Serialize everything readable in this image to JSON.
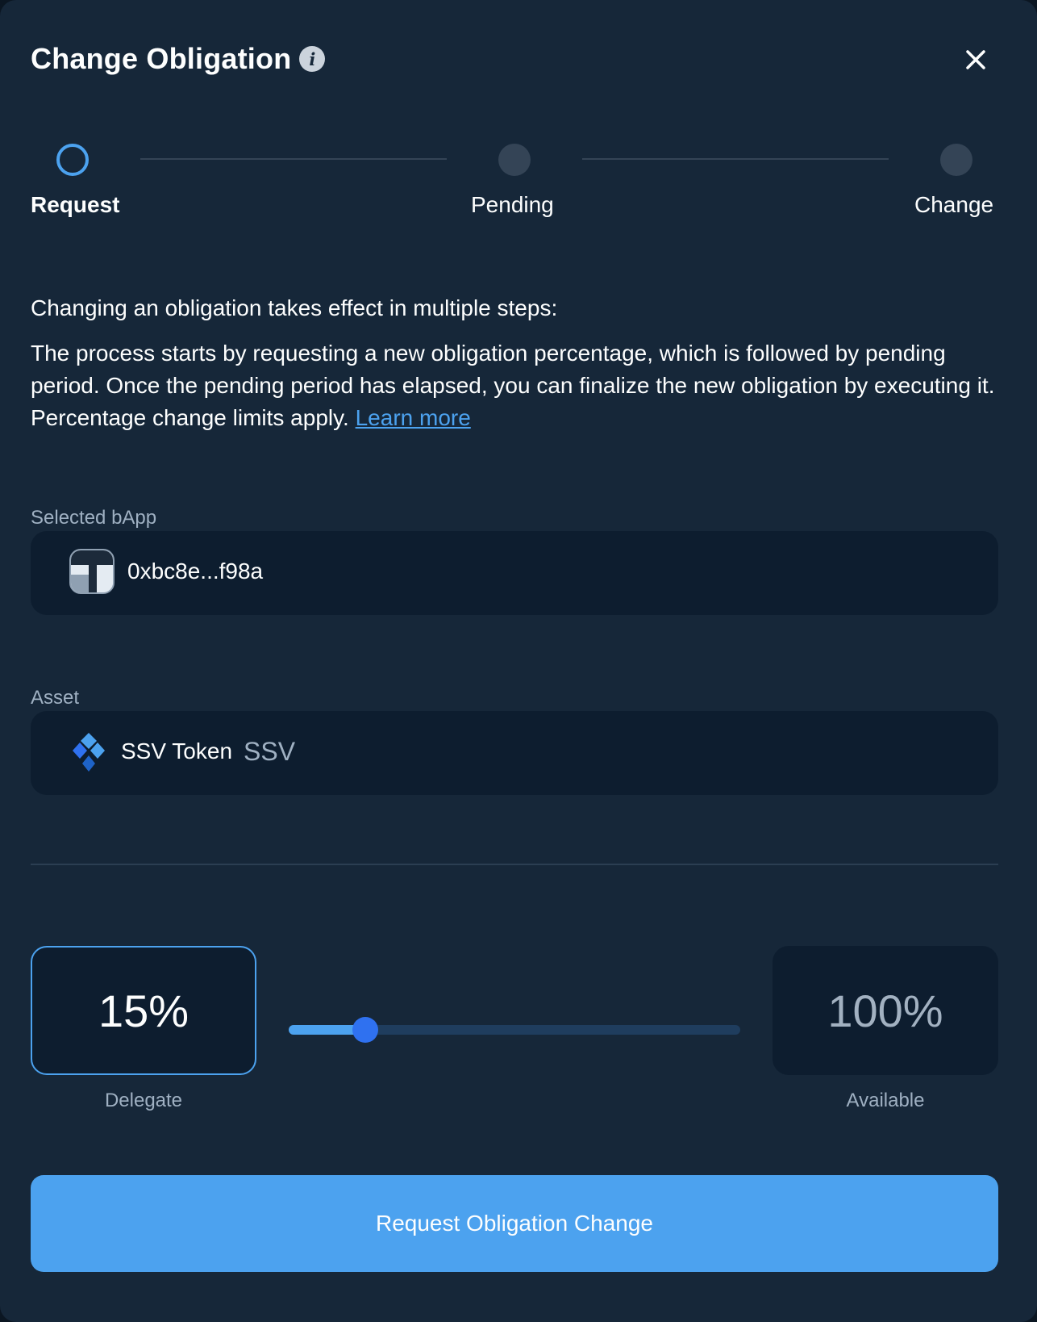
{
  "modal": {
    "title": "Change Obligation",
    "info_icon": "info-icon",
    "close_icon": "close-icon"
  },
  "stepper": {
    "steps": [
      {
        "label": "Request",
        "state": "active"
      },
      {
        "label": "Pending",
        "state": "upcoming"
      },
      {
        "label": "Change",
        "state": "upcoming"
      }
    ]
  },
  "description": {
    "intro": "Changing an obligation takes effect in multiple steps:",
    "body": "The process starts by requesting a new obligation percentage, which is followed by pending period. Once the pending period has elapsed, you can finalize the new obligation by executing it. Percentage change limits apply.",
    "link": "Learn more"
  },
  "selected_bapp": {
    "label": "Selected bApp",
    "value": "0xbc8e...f98a",
    "icon": "bapp-avatar"
  },
  "asset": {
    "label": "Asset",
    "name": "SSV Token",
    "symbol": "SSV",
    "icon": "ssv-token-icon"
  },
  "obligation": {
    "delegate_value": "15%",
    "delegate_label": "Delegate",
    "available_value": "100%",
    "available_label": "Available",
    "slider_fraction": 0.17
  },
  "actions": {
    "submit_label": "Request Obligation Change"
  },
  "colors": {
    "accent": "#4ca2ef",
    "slider_thumb": "#2f71f0",
    "background": "#162739",
    "field": "#0d1d2f"
  }
}
